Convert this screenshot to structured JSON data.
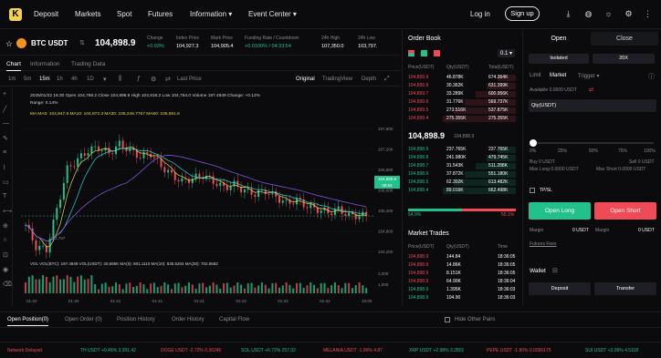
{
  "nav": {
    "logo": "K",
    "items": [
      "Deposit",
      "Markets",
      "Spot",
      "Futures",
      "Information ▾",
      "Event Center ▾"
    ],
    "login": "Log in",
    "signup": "Sign up"
  },
  "ticker": {
    "pair": "BTC USDT",
    "price": "104,898.9",
    "stats": [
      {
        "label": "Change",
        "value": "+0.93%",
        "color": "g"
      },
      {
        "label": "Index Price",
        "value": "104,927.3",
        "color": "w"
      },
      {
        "label": "Mark Price",
        "value": "104,905.4",
        "color": "w"
      },
      {
        "label": "Funding Rate / Countdown",
        "value": "+0.0100% / 04:33:54",
        "color": "g"
      },
      {
        "label": "24h High",
        "value": "107,350.0",
        "color": "w"
      },
      {
        "label": "24h Low",
        "value": "103,797.",
        "color": "w"
      }
    ]
  },
  "chart_tabs": [
    "Chart",
    "Information",
    "Trading Data"
  ],
  "toolbar": {
    "intervals": [
      "1m",
      "5m",
      "15m",
      "1h",
      "4h",
      "1D"
    ],
    "last_price": "Last Price",
    "views": [
      "Original",
      "TradingView",
      "Depth"
    ]
  },
  "chart_info": {
    "ohlc": "2025/01/22 16:30  Open 104,768.2  Close 104,898.9  High 104,918.2  Low 104,764.0  Volume 197.4849  Change: +0.12%",
    "range": "Range: 0.14%",
    "ma": "MA  MA5: 104,947.6  MA10: 104,972.3  MA30: 105,246.7767  MA60: 105,591.6",
    "vol": "VOL  VOL(BTC): 197.4849  VOL(USDT): 20,695K  MA(5): 801.1110  MA(10): 835.5204  MA(30): 702.8582",
    "low_label": "103,797",
    "y_ticks": [
      "107,800",
      "107,200",
      "106,600",
      "106,000",
      "105,400",
      "104,800",
      "104,200"
    ],
    "price_tag": "104,898.9",
    "price_tag2": "08:54",
    "vol_ticks": [
      "2,000",
      "1,000"
    ],
    "x_ticks": [
      "01-20",
      "01-20",
      "01-21",
      "01-21",
      "01-21",
      "01-22",
      "01-22",
      "01-22",
      "16:00"
    ]
  },
  "chart_data": {
    "type": "candlestick",
    "x": [
      "01-20",
      "01-20",
      "01-21",
      "01-21",
      "01-21",
      "01-22",
      "01-22",
      "01-22",
      "16:00"
    ],
    "ylim": [
      103600,
      108000
    ],
    "close": [
      104600,
      103900,
      103800,
      105100,
      106400,
      106700,
      107000,
      107100,
      106900,
      107200,
      107000,
      106800,
      106900,
      106500,
      106200,
      106000,
      106100,
      106200,
      106000,
      105800,
      105900,
      105700,
      105600,
      105700,
      105500,
      105300,
      105400,
      105200,
      105100,
      105000,
      105100,
      104900,
      104900
    ]
  },
  "orderbook": {
    "title": "Order Book",
    "step": "0.1 ▾",
    "headers": [
      "Price(USDT)",
      "Qty(USDT)",
      "Total(USDT)"
    ],
    "asks": [
      [
        "104,899.9",
        "46.878K",
        "674.364K"
      ],
      [
        "104,899.8",
        "30.362K",
        "631.399K"
      ],
      [
        "104,899.7",
        "33.289K",
        "600.956K"
      ],
      [
        "104,899.6",
        "31.776K",
        "569.737K"
      ],
      [
        "104,899.5",
        "273.516K",
        "537.875K"
      ],
      [
        "104,899.4",
        "275.355K",
        "275.355K"
      ]
    ],
    "mid": "104,898.9",
    "mid_sub": "104,898.9",
    "bids": [
      [
        "104,898.9",
        "237.765K",
        "237.765K"
      ],
      [
        "104,898.8",
        "241.980K",
        "479.745K"
      ],
      [
        "104,898.7",
        "31.543K",
        "511.288K"
      ],
      [
        "104,898.6",
        "37.872K",
        "551.180K"
      ],
      [
        "104,898.5",
        "62.302K",
        "613.482K"
      ],
      [
        "104,898.4",
        "89.016K",
        "662.498K"
      ]
    ],
    "buy_pct": "54.9%",
    "sell_pct": "55.1%"
  },
  "market_trades": {
    "title": "Market Trades",
    "headers": [
      "Price(USDT)",
      "Qty(USDT)",
      "Time"
    ],
    "rows": [
      [
        "104,898.9",
        "144.84",
        "18:36:05",
        "r"
      ],
      [
        "104,898.9",
        "14.86K",
        "18:36:05",
        "r"
      ],
      [
        "104,898.9",
        "8.151K",
        "18:36:05",
        "r"
      ],
      [
        "104,898.9",
        "64.90K",
        "18:36:04",
        "r"
      ],
      [
        "104,898.9",
        "1.395K",
        "18:36:03",
        "g"
      ],
      [
        "104,898.9",
        "104.90",
        "18:36:03",
        "g"
      ]
    ]
  },
  "trade": {
    "open": "Open",
    "close": "Close",
    "isolated": "Isolated",
    "leverage": "20X",
    "order_types": [
      "Limit",
      "Market",
      "Trigger ▾"
    ],
    "available": "Available 0.0000 USDT",
    "qty": "Qty(USDT)",
    "slider_marks": [
      "0%",
      "25%",
      "50%",
      "75%",
      "100%"
    ],
    "buy_qty": "Buy 0 USDT",
    "sell_qty": "Sell 0 USDT",
    "max_long": "Max Long 0.0000 USDT",
    "max_short": "Max Short 0.0000 USDT",
    "tpsl": "TP/SL",
    "open_long": "Open Long",
    "open_short": "Open Short",
    "margin_l": "Margin",
    "margin_lv": "0 USDT",
    "margin_r": "Margin",
    "margin_rv": "0 USDT",
    "fees": "Futures Fees",
    "wallet": "Wallet",
    "deposit": "Deposit",
    "transfer": "Transfer"
  },
  "bottom_tabs": [
    "Open Position(0)",
    "Open Order (0)",
    "Position History",
    "Order History",
    "Capital Flow"
  ],
  "hide_pairs": "Hide Other Pairs",
  "marquee": [
    {
      "t": "Network Delayed",
      "c": "r"
    },
    {
      "t": "TH USDT  +0.46%  3,391.42",
      "c": "g"
    },
    {
      "t": "DOGE USDT  -2.72%  0.36246",
      "c": "r"
    },
    {
      "t": "SOL USDT  +6.72%  257.02",
      "c": "g"
    },
    {
      "t": "MELANIA USDT  -1.96%  4.87",
      "c": "r"
    },
    {
      "t": "XRP USDT  +2.98%  3.2801",
      "c": "g"
    },
    {
      "t": "PEPE USDT  -1.80%  0.0000175",
      "c": "r"
    },
    {
      "t": "SUI USDT  +3.09%  4.5118",
      "c": "g"
    }
  ]
}
